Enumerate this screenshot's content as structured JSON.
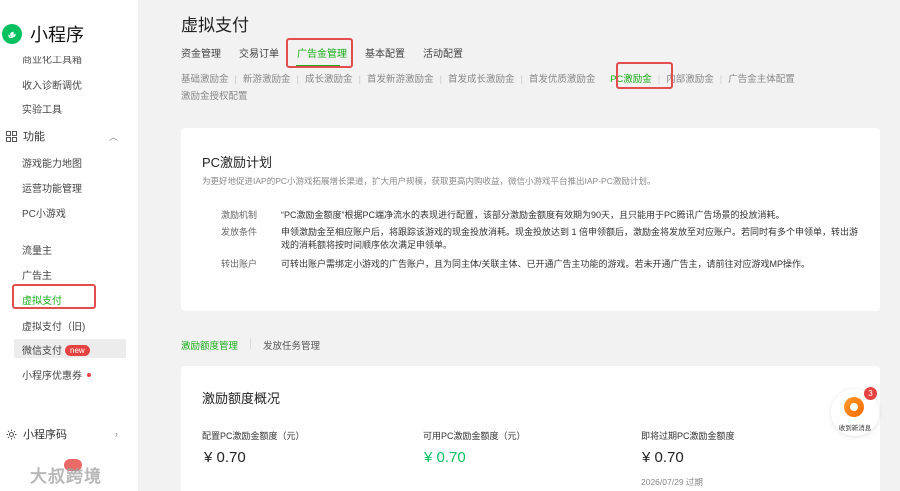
{
  "app": {
    "title": "小程序"
  },
  "sidebar": {
    "cut_item": "商业化工具箱",
    "items_top": [
      "收入诊断调优",
      "实验工具"
    ],
    "section_label": "功能",
    "items_mid": [
      "游戏能力地图",
      "运营功能管理",
      "PC小游戏"
    ],
    "items_bottom": [
      "流量主",
      "广告主",
      "虚拟支付",
      "虚拟支付（旧)"
    ],
    "wechat_pay": "微信支付",
    "new_badge": "new",
    "coupon": "小程序优惠券",
    "qrcode_section": "小程序码"
  },
  "watermark": "大叔跨境",
  "main": {
    "title": "虚拟支付",
    "tabs": [
      "资金管理",
      "交易订单",
      "广告金管理",
      "基本配置",
      "活动配置"
    ],
    "active_tab": 2,
    "subtabs": [
      "基础激励金",
      "新游激励金",
      "成长激励金",
      "首发新游激励金",
      "首发成长激励金",
      "首发优质激励金",
      "PC激励金",
      "内部激励金",
      "广告金主体配置",
      "激励金授权配置"
    ],
    "active_subtab": 6
  },
  "plan": {
    "title": "PC激励计划",
    "subtitle": "为更好地促进IAP的PC小游戏拓展增长渠道，扩大用户规模，获取更高内购收益，微信小游戏平台推出IAP-PC激励计划。",
    "rules": [
      {
        "label": "激励机制",
        "text": "“PC激励金额度”根据PC端净流水的表现进行配置，该部分激励金额度有效期为90天，且只能用于PC腾讯广告场景的投放消耗。"
      },
      {
        "label": "发放条件",
        "text": "申领激励金至相应账户后，将跟踪该游戏的现金投放消耗。现金投放达到 1 倍申领额后，激励金将发放至对应账户。若同时有多个申领单，转出游戏的消耗额将按时间顺序依次满足申领单。"
      },
      {
        "label": "转出账户",
        "text": "可转出账户需绑定小游戏的广告账户，且为同主体/关联主体、已开通广告主功能的游戏。若未开通广告主，请前往对应游戏MP操作。"
      }
    ]
  },
  "subnav": {
    "items": [
      "激励额度管理",
      "发放任务管理"
    ],
    "active": 0
  },
  "overview": {
    "title": "激励额度概况",
    "metrics": [
      {
        "label": "配置PC激励金额度（元）",
        "value": "¥ 0.70"
      },
      {
        "label": "可用PC激励金额度（元）",
        "value": "¥ 0.70"
      },
      {
        "label": "即将过期PC激励金额度",
        "value": "¥ 0.70",
        "note": "2026/07/29 过期"
      }
    ]
  },
  "float_widget": {
    "label": "收到新消息",
    "count": "3"
  },
  "colors": {
    "accent": "#07c160",
    "highlight": "#e34d4d",
    "badge": "#e64340"
  }
}
